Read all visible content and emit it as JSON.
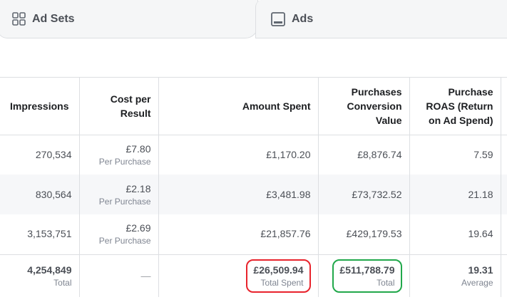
{
  "tabs": [
    {
      "label": "Ad Sets",
      "icon": "ad-sets-grid-icon"
    },
    {
      "label": "Ads",
      "icon": "ads-monitor-icon"
    }
  ],
  "table": {
    "headers": [
      "Impressions",
      "Cost per Result",
      "Amount Spent",
      "Purchases Conversion Value",
      "Purchase ROAS (Return on Ad Spend)"
    ],
    "header_lines": {
      "cost_per_result": [
        "Cost per",
        "Result"
      ],
      "purchases_value": [
        "Purchases",
        "Conversion",
        "Value"
      ],
      "roas": [
        "Purchase",
        "ROAS (Return",
        "on Ad Spend)"
      ]
    },
    "rows": [
      {
        "impressions": "270,534",
        "cost": "£7.80",
        "cost_sub": "Per Purchase",
        "spent": "£1,170.20",
        "value": "£8,876.74",
        "roas": "7.59"
      },
      {
        "impressions": "830,564",
        "cost": "£2.18",
        "cost_sub": "Per Purchase",
        "spent": "£3,481.98",
        "value": "£73,732.52",
        "roas": "21.18"
      },
      {
        "impressions": "3,153,751",
        "cost": "£2.69",
        "cost_sub": "Per Purchase",
        "spent": "£21,857.76",
        "value": "£429,179.53",
        "roas": "19.64"
      }
    ],
    "totals": {
      "impressions": "4,254,849",
      "impressions_sub": "Total",
      "cost": "—",
      "spent": "£26,509.94",
      "spent_sub": "Total Spent",
      "value": "£511,788.79",
      "value_sub": "Total",
      "roas": "19.31",
      "roas_sub": "Average"
    }
  },
  "annotations": {
    "spent_highlight_color": "#e8232c",
    "value_highlight_color": "#21a84b"
  }
}
